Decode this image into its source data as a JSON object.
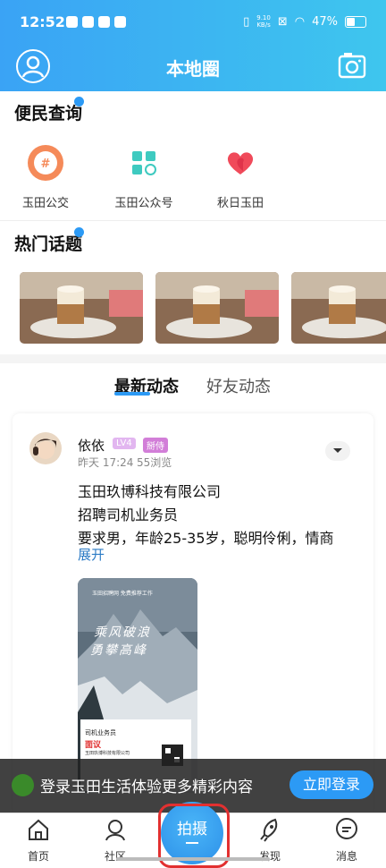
{
  "status": {
    "time": "12:52",
    "speed_top": "9.10",
    "speed_bottom": "KB/s",
    "battery": "47%"
  },
  "header": {
    "title": "本地圈"
  },
  "services": {
    "title": "便民查询",
    "items": [
      {
        "label": "玉田公交"
      },
      {
        "label": "玉田公众号"
      },
      {
        "label": "秋日玉田"
      }
    ]
  },
  "topics": {
    "title": "热门话题"
  },
  "feed_tabs": {
    "active": "最新动态",
    "inactive": "好友动态"
  },
  "post": {
    "author": "依依",
    "level_badge": "LV4",
    "tag_badge": "掰侍",
    "time": "昨天 17:24",
    "views": "55浏览",
    "lines": [
      "玉田玖博科技有限公司",
      "招聘司机业务员",
      "要求男，年龄25-35岁，聪明伶俐，情商"
    ],
    "expand": "展开",
    "image": {
      "top_text": "玉田招聘网 免费推荐工作",
      "calligraphy_1": "乘风破浪",
      "calligraphy_2": "勇攀高峰",
      "card_title": "司机业务员",
      "card_salary": "面议",
      "card_company": "玉田玖博科技有限公司"
    }
  },
  "login_bar": {
    "text": "登录玉田生活体验更多精彩内容",
    "button": "立即登录"
  },
  "bottom_nav": {
    "home": "首页",
    "community": "社区",
    "shoot": "拍摄",
    "discover": "发现",
    "messages": "消息"
  },
  "colors": {
    "accent": "#2c9af5",
    "header_start": "#3aa3f5",
    "header_end": "#3ec6ee"
  }
}
